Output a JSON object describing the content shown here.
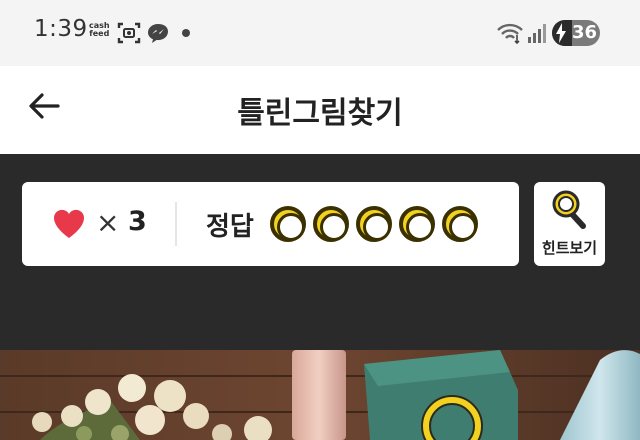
{
  "status_bar": {
    "time": "1:39",
    "cashfeed_line1": "cash",
    "cashfeed_line2": "feed",
    "battery_level": "36",
    "icons": [
      "cashfeed-icon",
      "screenshot-icon",
      "messenger-icon",
      "notification-dot-icon",
      "wifi-icon",
      "signal-icon",
      "battery-icon"
    ]
  },
  "header": {
    "title": "틀린그림찾기",
    "back_icon": "arrow-left-icon"
  },
  "game": {
    "lives_count": "3",
    "lives_symbol": "×",
    "answer_label": "정답",
    "answer_slots_total": 5,
    "answer_slots_found": 0,
    "hint_label": "힌트보기",
    "hint_icon": "magnifier-icon"
  },
  "colors": {
    "panel_bg": "#2a2a2a",
    "accent_yellow": "#f2d21f",
    "heart_red": "#e8394b"
  }
}
